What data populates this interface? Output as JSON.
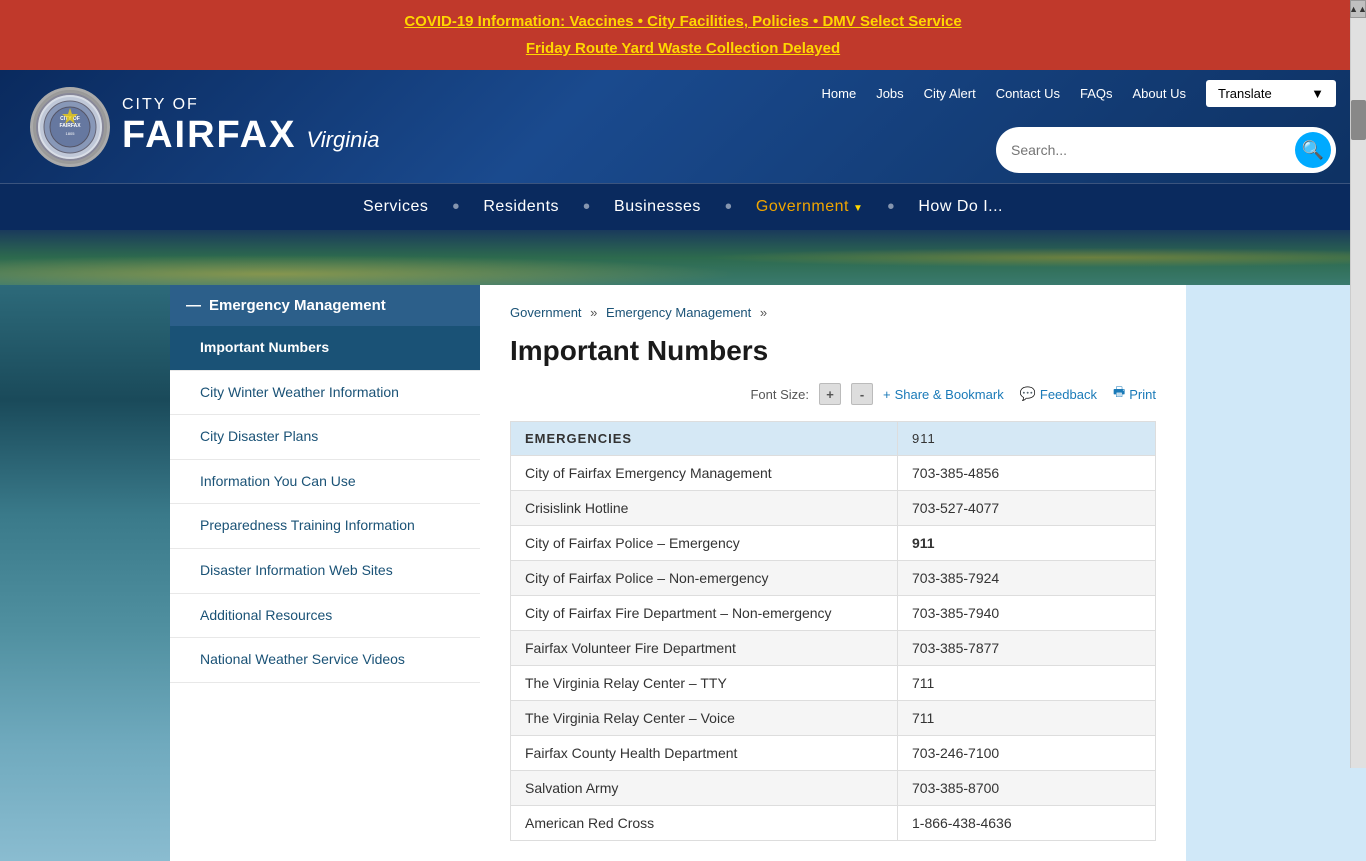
{
  "alert": {
    "line1": "COVID-19 Information: Vaccines • City Facilities, Policies • DMV Select Service",
    "line2": "Friday Route Yard Waste Collection Delayed"
  },
  "header": {
    "city_of": "CITY OF",
    "fairfax": "FAIRFAX",
    "virginia": "Virginia",
    "seal_text": "CITY OF FAIRFAX 1805"
  },
  "top_nav": {
    "links": [
      "Home",
      "Jobs",
      "City Alert",
      "Contact Us",
      "FAQs",
      "About Us"
    ],
    "translate_label": "Translate"
  },
  "search": {
    "placeholder": "Search..."
  },
  "main_nav": {
    "items": [
      {
        "label": "Services",
        "active": false
      },
      {
        "label": "Residents",
        "active": false
      },
      {
        "label": "Businesses",
        "active": false
      },
      {
        "label": "Government",
        "active": true
      },
      {
        "label": "How Do I...",
        "active": false
      }
    ]
  },
  "sidebar": {
    "header": "Emergency Management",
    "items": [
      {
        "label": "Important Numbers",
        "active": true,
        "href": "#"
      },
      {
        "label": "City Winter Weather Information",
        "active": false,
        "href": "#"
      },
      {
        "label": "City Disaster Plans",
        "active": false,
        "href": "#"
      },
      {
        "label": "Information You Can Use",
        "active": false,
        "href": "#"
      },
      {
        "label": "Preparedness Training Information",
        "active": false,
        "href": "#"
      },
      {
        "label": "Disaster Information Web Sites",
        "active": false,
        "href": "#"
      },
      {
        "label": "Additional Resources",
        "active": false,
        "href": "#"
      },
      {
        "label": "National Weather Service Videos",
        "active": false,
        "href": "#"
      }
    ]
  },
  "breadcrumb": {
    "items": [
      "Government",
      "Emergency Management"
    ],
    "separator": "»"
  },
  "page": {
    "title": "Important Numbers",
    "font_size_label": "Font Size:",
    "increase_label": "+",
    "decrease_label": "-",
    "share_label": "Share & Bookmark",
    "feedback_label": "Feedback",
    "print_label": "Print"
  },
  "table": {
    "header_row": {
      "col1": "EMERGENCIES",
      "col2": "911"
    },
    "rows": [
      {
        "name": "City of Fairfax Emergency Management",
        "number": "703-385-4856",
        "bold": false
      },
      {
        "name": "Crisislink Hotline",
        "number": "703-527-4077",
        "bold": false
      },
      {
        "name": "City of Fairfax Police – Emergency",
        "number": "911",
        "bold": true
      },
      {
        "name": "City of Fairfax Police – Non-emergency",
        "number": "703-385-7924",
        "bold": false
      },
      {
        "name": "City of Fairfax Fire Department – Non-emergency",
        "number": "703-385-7940",
        "bold": false
      },
      {
        "name": "Fairfax Volunteer Fire Department",
        "number": "703-385-7877",
        "bold": false
      },
      {
        "name": "The Virginia Relay Center – TTY",
        "number": "711",
        "bold": false
      },
      {
        "name": "The Virginia Relay Center – Voice",
        "number": "711",
        "bold": false
      },
      {
        "name": "Fairfax County Health Department",
        "number": "703-246-7100",
        "bold": false
      },
      {
        "name": "Salvation Army",
        "number": "703-385-8700",
        "bold": false
      },
      {
        "name": "American Red Cross",
        "number": "1-866-438-4636",
        "bold": false
      }
    ]
  },
  "colors": {
    "alert_bg": "#c0392b",
    "header_bg": "#0a2a5e",
    "nav_active": "#f0a500",
    "sidebar_header": "#2c5f8a",
    "sidebar_active": "#1a5276",
    "link_color": "#1a7ab8",
    "table_header_bg": "#d5e8f5"
  }
}
